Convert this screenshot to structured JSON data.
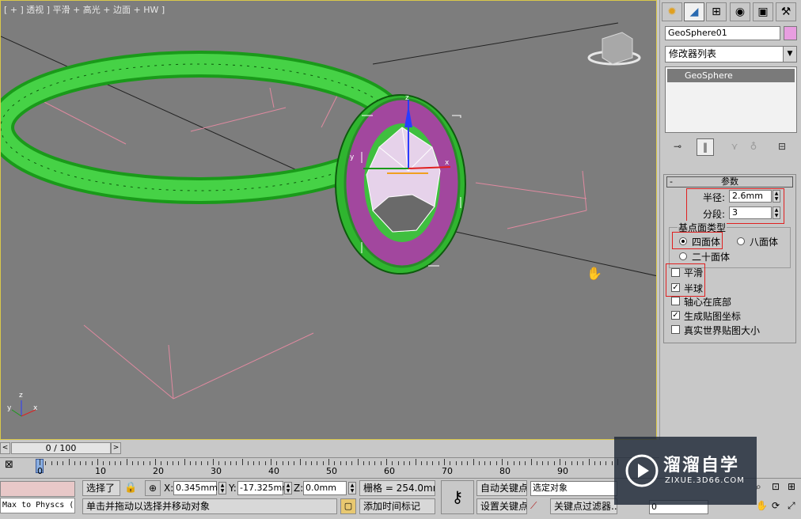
{
  "viewport": {
    "label": "[ + ] 透视 ] 平滑 + 高光 + 边面 + HW ]",
    "axis_labels": {
      "z": "z",
      "x": "x",
      "y": "y"
    }
  },
  "command_panel": {
    "tabs": [
      "create-icon",
      "modify-icon",
      "hierarchy-icon",
      "motion-icon",
      "display-icon",
      "utilities-icon"
    ],
    "object_name": "GeoSphere01",
    "object_color": "#e89ee0",
    "modifier_list": "修改器列表",
    "stack_item": "GeoSphere",
    "rollout": {
      "title": "参数",
      "radius_label": "半径:",
      "radius_value": "2.6mm",
      "segments_label": "分段:",
      "segments_value": "3",
      "base_type_label": "基点面类型",
      "tetra": "四面体",
      "octa": "八面体",
      "icosa": "二十面体",
      "smooth": "平滑",
      "hemisphere": "半球",
      "base_pivot": "轴心在底部",
      "gen_map": "生成贴图坐标",
      "real_world": "真实世界贴图大小"
    }
  },
  "timeline": {
    "frame": "0 / 100",
    "ticks": [
      "0",
      "10",
      "20",
      "30",
      "40",
      "50",
      "60",
      "70",
      "80",
      "90"
    ]
  },
  "status": {
    "script_listener": "Max to Physcs (",
    "selected": "选择了",
    "x_label": "X:",
    "x_value": "0.345mm",
    "y_label": "Y:",
    "y_value": "-17.325mm",
    "z_label": "Z:",
    "z_value": "0.0mm",
    "grid": "栅格 = 254.0mm",
    "prompt": "单击并拖动以选择并移动对象",
    "add_time_tag": "添加时间标记",
    "auto_key": "自动关键点",
    "set_key": "设置关键点",
    "selected_object": "选定对象",
    "key_filter": "关键点过滤器...",
    "frame_field": "0"
  },
  "watermark": {
    "title": "溜溜自学",
    "url": "ZIXUE.3D66.COM"
  }
}
